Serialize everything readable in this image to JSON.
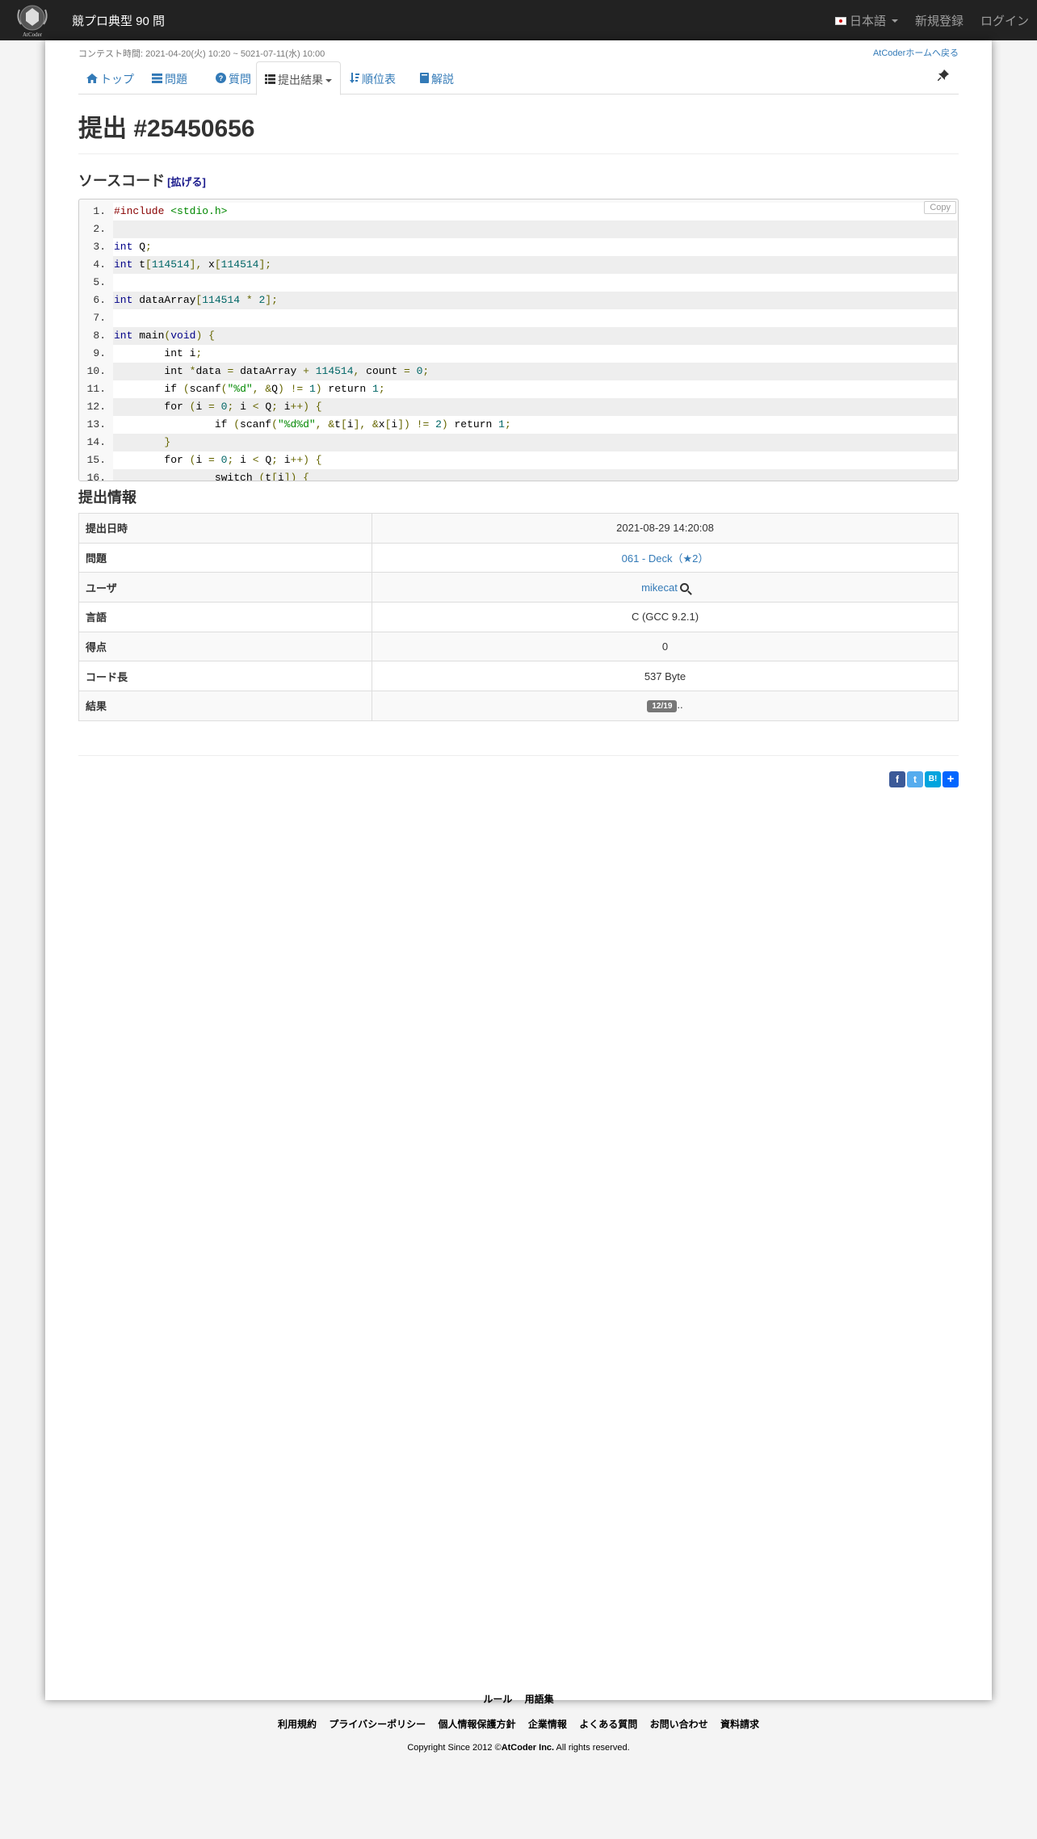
{
  "navbar": {
    "brand": "競プロ典型 90 問",
    "lang": "日本語",
    "signup": "新規登録",
    "login": "ログイン",
    "logo_text": "AtCoder"
  },
  "contest": {
    "time_label": "コンテスト時間: 2021-04-20(火) 10:20 ~ 5021-07-11(水) 10:00",
    "home_link": "AtCoderホームへ戻る"
  },
  "tabs": [
    {
      "label": "トップ",
      "icon": "home-icon"
    },
    {
      "label": "問題",
      "icon": "tasks-icon"
    },
    {
      "label": "質問",
      "icon": "question-icon"
    },
    {
      "label": "提出結果",
      "icon": "list-icon"
    },
    {
      "label": "順位表",
      "icon": "sort-icon"
    },
    {
      "label": "解説",
      "icon": "book-icon"
    }
  ],
  "page_title": "提出 #25450656",
  "source": {
    "heading": "ソースコード",
    "expand_label": "[拡げる]",
    "copy_label": "Copy",
    "lines": [
      {
        "n": "1.",
        "code": "#include <stdio.h>"
      },
      {
        "n": "2.",
        "code": ""
      },
      {
        "n": "3.",
        "code": "int Q;"
      },
      {
        "n": "4.",
        "code": "int t[114514], x[114514];"
      },
      {
        "n": "5.",
        "code": ""
      },
      {
        "n": "6.",
        "code": "int dataArray[114514 * 2];"
      },
      {
        "n": "7.",
        "code": ""
      },
      {
        "n": "8.",
        "code": "int main(void) {"
      },
      {
        "n": "9.",
        "code": "\tint i;"
      },
      {
        "n": "10.",
        "code": "\tint *data = dataArray + 114514, count = 0;"
      },
      {
        "n": "11.",
        "code": "\tif (scanf(\"%d\", &Q) != 1) return 1;"
      },
      {
        "n": "12.",
        "code": "\tfor (i = 0; i < Q; i++) {"
      },
      {
        "n": "13.",
        "code": "\t\tif (scanf(\"%d%d\", &t[i], &x[i]) != 2) return 1;"
      },
      {
        "n": "14.",
        "code": "\t}"
      },
      {
        "n": "15.",
        "code": "\tfor (i = 0; i < Q; i++) {"
      },
      {
        "n": "16.",
        "code": "\t\tswitch (t[i]) {"
      }
    ]
  },
  "info": {
    "heading": "提出情報",
    "rows": [
      {
        "key": "提出日時",
        "value": "2021-08-29 14:20:08"
      },
      {
        "key": "問題",
        "value": "061 - Deck（★2）"
      },
      {
        "key": "ユーザ",
        "value": "mikecat"
      },
      {
        "key": "言語",
        "value": "C (GCC 9.2.1)"
      },
      {
        "key": "得点",
        "value": "0"
      },
      {
        "key": "コード長",
        "value": "537 Byte"
      },
      {
        "key": "結果",
        "value": "12/19",
        "suffix": ".."
      }
    ]
  },
  "share": [
    "f",
    "t",
    "B!",
    "+"
  ],
  "footer": {
    "row1": [
      "ルール",
      "用語集"
    ],
    "row2": [
      "利用規約",
      "プライバシーポリシー",
      "個人情報保護方針",
      "企業情報",
      "よくある質問",
      "お問い合わせ",
      "資料請求"
    ],
    "copyright_prefix": "Copyright Since 2012 ©",
    "copyright_company": "AtCoder Inc.",
    "copyright_suffix": " All rights reserved."
  }
}
